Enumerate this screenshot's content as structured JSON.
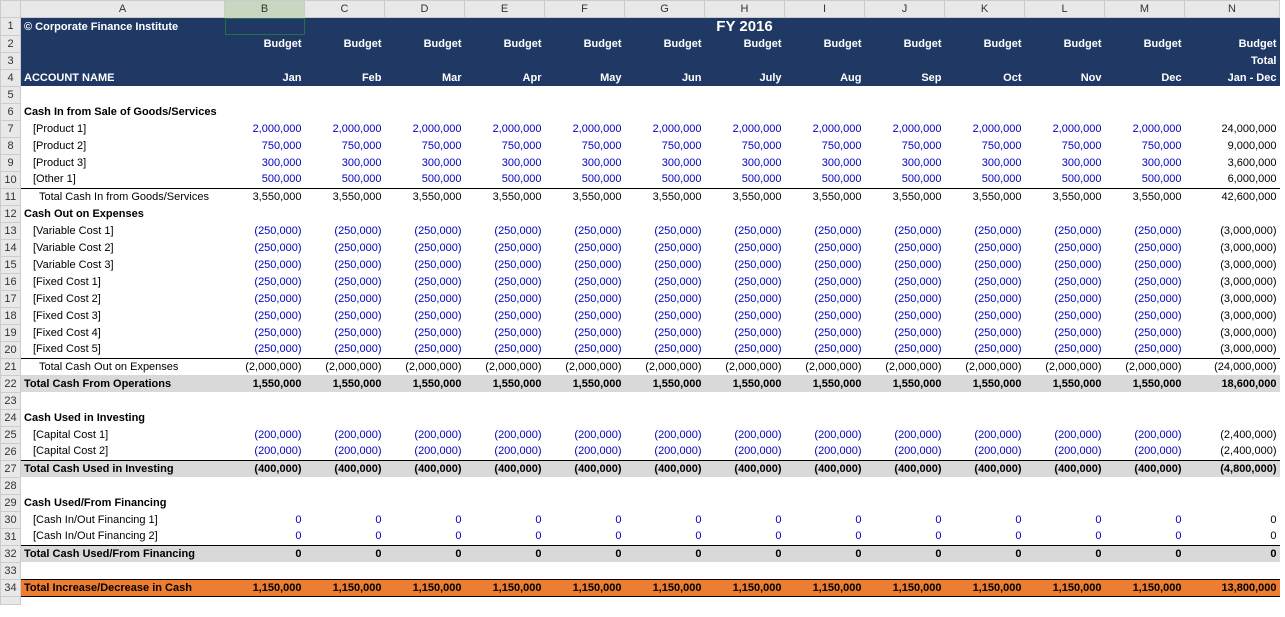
{
  "columns": [
    "A",
    "B",
    "C",
    "D",
    "E",
    "F",
    "G",
    "H",
    "I",
    "J",
    "K",
    "L",
    "M",
    "N"
  ],
  "title_year": "FY 2016",
  "copyright": "© Corporate Finance Institute",
  "budget_label": "Budget",
  "budget_total_top": "Budget",
  "budget_total_bottom": "Total",
  "account_name": "ACCOUNT NAME",
  "months": [
    "Jan",
    "Feb",
    "Mar",
    "Apr",
    "May",
    "Jun",
    "July",
    "Aug",
    "Sep",
    "Oct",
    "Nov",
    "Dec"
  ],
  "jandec": "Jan - Dec",
  "s_cashin": "Cash In from Sale of Goods/Services",
  "prod": [
    "[Product 1]",
    "[Product 2]",
    "[Product 3]",
    "[Other 1]"
  ],
  "v2m": "2,000,000",
  "v750": "750,000",
  "v300": "300,000",
  "v500": "500,000",
  "t24m": "24,000,000",
  "t9m": "9,000,000",
  "t36m": "3,600,000",
  "t6m": "6,000,000",
  "s_totalcashin": "Total Cash In from Goods/Services",
  "v355": "3,550,000",
  "t426": "42,600,000",
  "s_cashout": "Cash Out on Expenses",
  "costs": [
    "[Variable Cost 1]",
    "[Variable Cost 2]",
    "[Variable Cost 3]",
    "[Fixed Cost 1]",
    "[Fixed Cost 2]",
    "[Fixed Cost 3]",
    "[Fixed Cost 4]",
    "[Fixed Cost 5]"
  ],
  "v250n": "(250,000)",
  "t3mn": "(3,000,000)",
  "s_totalcashout": "Total Cash Out on Expenses",
  "v2mn": "(2,000,000)",
  "t24mn": "(24,000,000)",
  "s_totalops": "Total Cash From Operations",
  "v155": "1,550,000",
  "t186": "18,600,000",
  "s_invest": "Cash Used in Investing",
  "cap": [
    "[Capital Cost 1]",
    "[Capital Cost 2]"
  ],
  "v200n": "(200,000)",
  "t24n": "(2,400,000)",
  "s_totalinvest": "Total Cash Used in Investing",
  "v400n": "(400,000)",
  "t48n": "(4,800,000)",
  "s_fin": "Cash Used/From Financing",
  "fin": [
    "[Cash In/Out Financing 1]",
    "[Cash In/Out Financing 2]"
  ],
  "v0": "0",
  "s_totalfin": "Total Cash Used/From Financing",
  "s_totalchange": "Total Increase/Decrease in Cash",
  "v115": "1,150,000",
  "t138": "13,800,000"
}
